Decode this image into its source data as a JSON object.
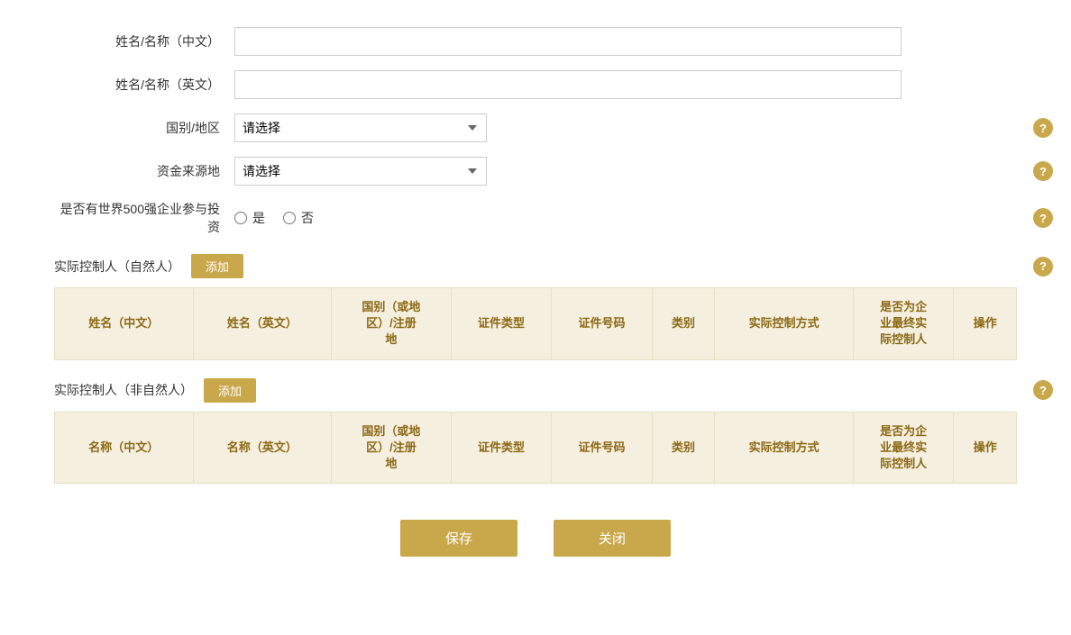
{
  "form": {
    "name_cn_label": "姓名/名称（中文）",
    "name_en_label": "姓名/名称（英文）",
    "country_label": "国别/地区",
    "country_placeholder": "请选择",
    "fund_source_label": "资金来源地",
    "fund_source_placeholder": "请选择",
    "fortune500_label": "是否有世界500强企业参与投资",
    "fortune500_yes": "是",
    "fortune500_no": "否"
  },
  "natural_person_section": {
    "title": "实际控制人（自然人）",
    "add_button": "添加",
    "columns": [
      "姓名（中文）",
      "姓名（英文）",
      "国别（或地区）/注册地",
      "证件类型",
      "证件号码",
      "类别",
      "实际控制方式",
      "是否为企业最终实际控制人",
      "操作"
    ]
  },
  "non_natural_person_section": {
    "title": "实际控制人（非自然人）",
    "add_button": "添加",
    "columns": [
      "名称（中文）",
      "名称（英文）",
      "国别（或地区）/注册地",
      "证件类型",
      "证件号码",
      "类别",
      "实际控制方式",
      "是否为企业最终实际控制人",
      "操作"
    ]
  },
  "buttons": {
    "save": "保存",
    "close": "关闭"
  },
  "help_icon": "?",
  "colors": {
    "gold": "#c9a84c",
    "table_header_bg": "#f5efe0",
    "table_header_text": "#8b6914"
  }
}
